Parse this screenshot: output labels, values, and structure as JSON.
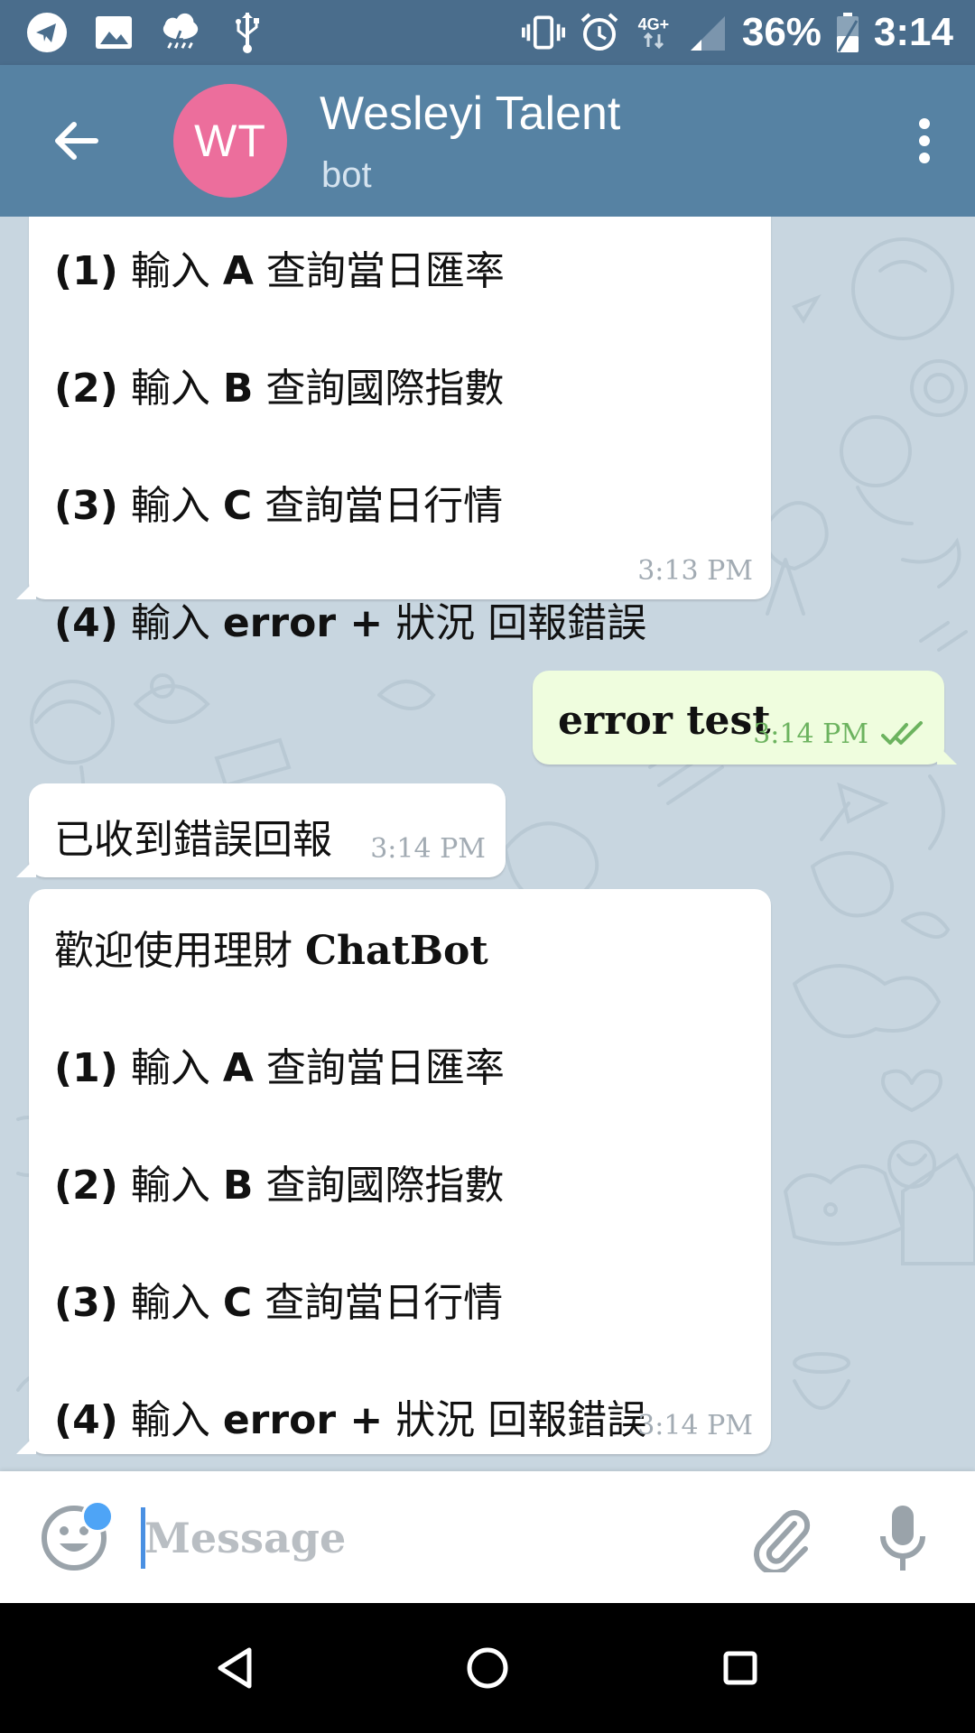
{
  "status_bar": {
    "battery": "36%",
    "time": "3:14",
    "network": "4G+",
    "left_icons": [
      "telegram-icon",
      "image-icon",
      "weather-icon",
      "usb-icon"
    ],
    "right_icons": [
      "vibrate-icon",
      "alarm-icon",
      "signal-icon",
      "battery-icon"
    ]
  },
  "header": {
    "avatar_initials": "WT",
    "title": "Wesleyi Talent",
    "subtitle": "bot",
    "avatar_color": "#ec6e9c",
    "bar_color": "#5682a3"
  },
  "messages": [
    {
      "direction": "in",
      "partial": true,
      "lines": [
        {
          "num": "(1)",
          "pre": "輸入",
          "key": "A",
          "post": "查詢當日匯率"
        },
        {
          "num": "(2)",
          "pre": "輸入",
          "key": "B",
          "post": "查詢國際指數"
        },
        {
          "num": "(3)",
          "pre": "輸入",
          "key": "C",
          "post": "查詢當日行情"
        },
        {
          "num": "(4)",
          "pre": "輸入",
          "key": "error +",
          "post": "狀況 回報錯誤"
        }
      ],
      "time": "3:13 PM"
    },
    {
      "direction": "out",
      "text": "error test",
      "time": "3:14 PM",
      "status": "read"
    },
    {
      "direction": "in",
      "text": "已收到錯誤回報",
      "time": "3:14 PM"
    },
    {
      "direction": "in",
      "heading_pre": "歡迎使用理財",
      "heading_key": "ChatBot",
      "lines": [
        {
          "num": "(1)",
          "pre": "輸入",
          "key": "A",
          "post": "查詢當日匯率"
        },
        {
          "num": "(2)",
          "pre": "輸入",
          "key": "B",
          "post": "查詢國際指數"
        },
        {
          "num": "(3)",
          "pre": "輸入",
          "key": "C",
          "post": "查詢當日行情"
        },
        {
          "num": "(4)",
          "pre": "輸入",
          "key": "error +",
          "post": "狀況 回報錯誤"
        }
      ],
      "time": "3:14 PM"
    }
  ],
  "input": {
    "placeholder": "Message",
    "value": ""
  }
}
